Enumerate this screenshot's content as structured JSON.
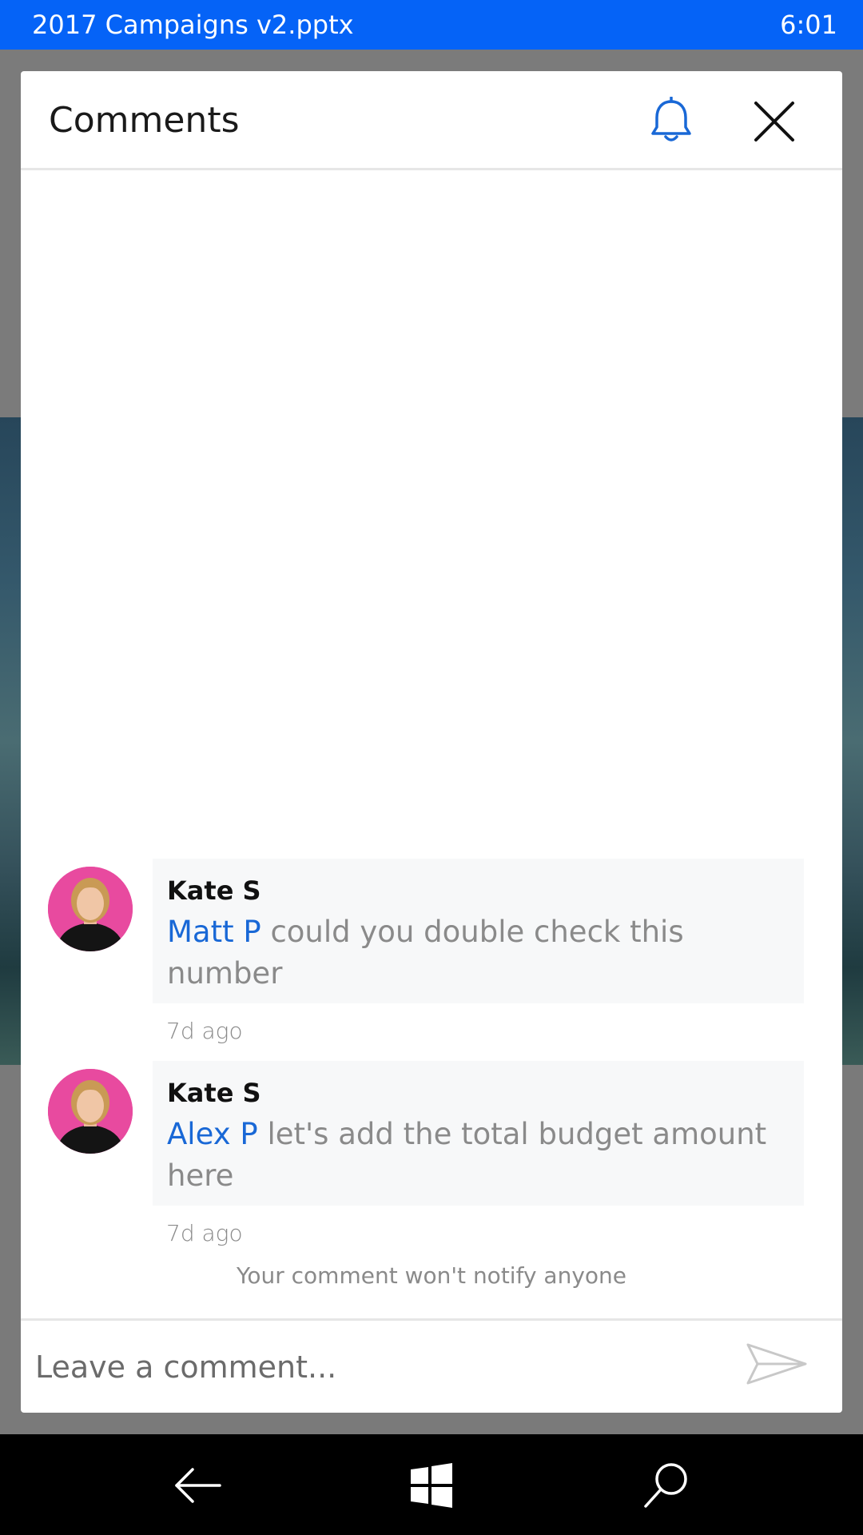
{
  "status_bar": {
    "file_title": "2017 Campaigns v2.pptx",
    "time": "6:01"
  },
  "comments_panel": {
    "title": "Comments",
    "icons": {
      "bell": "bell-icon",
      "close": "close-icon"
    },
    "comments": [
      {
        "author": "Kate S",
        "mention": "Matt P",
        "text": " could you double check this number",
        "time": "7d ago"
      },
      {
        "author": "Kate S",
        "mention": "Alex P",
        "text": " let's add the total budget amount here",
        "time": "7d ago"
      }
    ],
    "notify_note": "Your comment won't notify anyone",
    "composer": {
      "placeholder": "Leave a comment...",
      "send_icon": "send-icon"
    }
  },
  "nav_bar": {
    "back_icon": "back-arrow-icon",
    "home_icon": "windows-logo-icon",
    "search_icon": "search-icon"
  },
  "colors": {
    "status_bar": "#0563f7",
    "accent": "#1968d6",
    "avatar_bg": "#e84a9f"
  }
}
